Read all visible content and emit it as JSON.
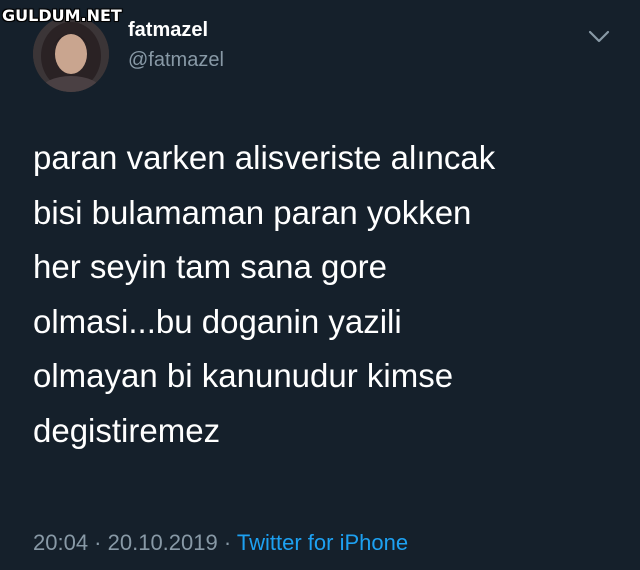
{
  "watermark": "GULDUM.NET",
  "author": {
    "display_name": "fatmazel",
    "handle": "@fatmazel"
  },
  "tweet": {
    "lines": [
      "paran varken alisveriste alıncak",
      "bisi bulamaman paran yokken",
      "her seyin tam sana gore",
      "olmasi...bu doganin yazili",
      "olmayan bi kanunudur kimse",
      "degistiremez"
    ]
  },
  "meta": {
    "time": "20:04",
    "separator": " · ",
    "date": "20.10.2019",
    "source": "Twitter for iPhone"
  },
  "icons": {
    "menu": "chevron-down-icon",
    "avatar": "profile-photo"
  },
  "colors": {
    "background": "#15202b",
    "secondary_text": "#8899a6",
    "link": "#1da1f2"
  }
}
